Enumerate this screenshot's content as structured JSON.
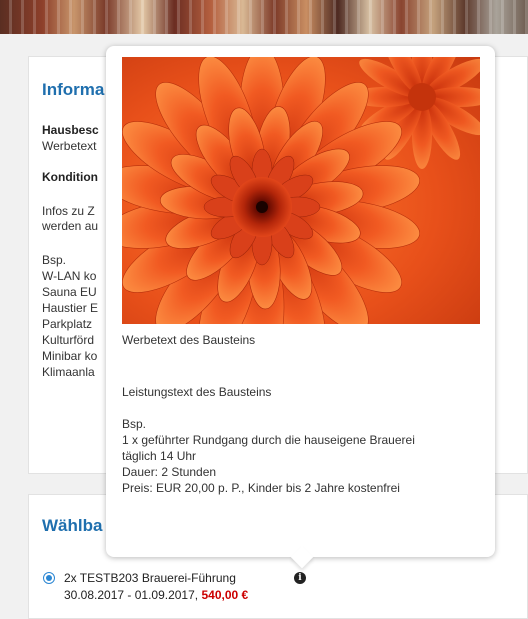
{
  "info_section": {
    "title": "Informa",
    "lines": [
      {
        "text": "Hausbesc",
        "bold": true
      },
      {
        "text": "Werbetext",
        "bold": false
      },
      {
        "text": "Kondition",
        "bold": true
      },
      {
        "text": "Infos zu Z",
        "bold": false
      },
      {
        "text": "werden au",
        "bold": false
      },
      {
        "text": "Bsp.",
        "bold": false
      },
      {
        "text": "W-LAN ko",
        "bold": false
      },
      {
        "text": "Sauna EU",
        "bold": false
      },
      {
        "text": "Haustier E",
        "bold": false
      },
      {
        "text": "Parkplatz",
        "bold": false
      },
      {
        "text": "Kulturförd",
        "bold": false
      },
      {
        "text": "Minibar ko",
        "bold": false
      },
      {
        "text": "Klimaanla",
        "bold": false
      }
    ]
  },
  "popover": {
    "image_alt": "orange-flower-image",
    "promo_text": "Werbetext des Bausteins",
    "service_text": "Leistungstext des Bausteins",
    "details": [
      "Bsp.",
      "1 x geführter Rundgang durch die hauseigene Brauerei",
      "täglich 14 Uhr",
      "Dauer: 2 Stunden",
      "Preis: EUR 20,00 p. P., Kinder bis 2 Jahre kostenfrei"
    ]
  },
  "select_section": {
    "title": "Wählba",
    "option": {
      "label": "2x TESTB203 Brauerei-Führung",
      "dates": "30.08.2017 - 01.09.2017,",
      "price": "540,00 €",
      "selected": true
    }
  },
  "colors": {
    "accent": "#1f6fae",
    "price": "#cc0000",
    "radio": "#2c87d3"
  },
  "icons": {
    "info": "info-circle-icon"
  }
}
